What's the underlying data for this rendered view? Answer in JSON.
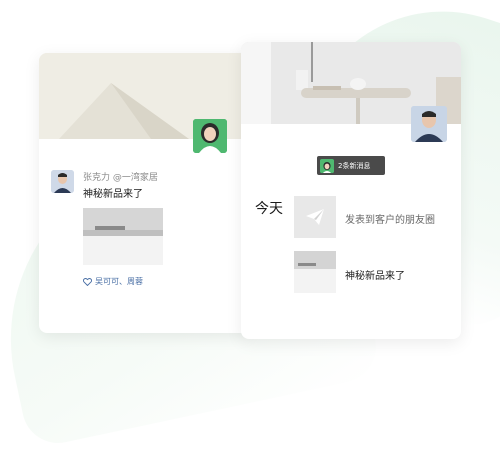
{
  "left_card": {
    "poster_name": "张克力 @一湾家居",
    "post_text": "神秘新品来了",
    "likes_text": "吴可可、周蓉"
  },
  "right_card": {
    "notification_text": "2条新消息",
    "date_label": "今天",
    "share_text": "发表到客户的朋友圈",
    "product_text": "神秘新品来了"
  },
  "icons": {
    "like": "heart-outline-icon",
    "share": "paper-plane-icon"
  },
  "colors": {
    "accent_green": "#4fb870",
    "link_blue": "#4a6fa5",
    "badge_dark": "#4a4a4a"
  }
}
